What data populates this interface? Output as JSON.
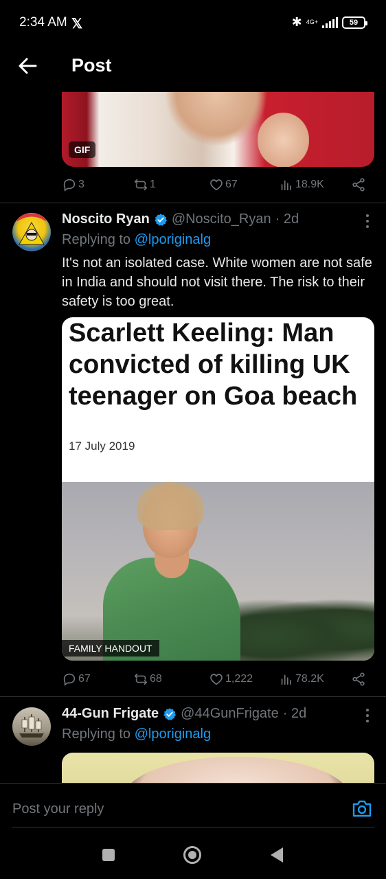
{
  "status_bar": {
    "time": "2:34 AM",
    "x_logo": "𝕏",
    "network": "4G+",
    "battery": "59"
  },
  "header": {
    "title": "Post"
  },
  "top_tweet": {
    "media_badge": "GIF",
    "replies": "3",
    "reposts": "1",
    "likes": "67",
    "views": "18.9K"
  },
  "tweet": {
    "name": "Noscito Ryan",
    "handle": "@Noscito_Ryan",
    "time": "· 2d",
    "replying_prefix": "Replying to ",
    "replying_to": "@lporiginalg",
    "text": "It's not an isolated case.  White women are not safe in India and should not visit there.  The risk to their safety is too great.",
    "article": {
      "headline": "Scarlett Keeling: Man convicted of killing UK teenager on Goa beach",
      "date": "17 July 2019",
      "caption": "FAMILY HANDOUT"
    },
    "replies": "67",
    "reposts": "68",
    "likes": "1,222",
    "views": "78.2K"
  },
  "third_tweet": {
    "name": "44-Gun Frigate",
    "handle": "@44GunFrigate",
    "time": "· 2d",
    "replying_prefix": "Replying to ",
    "replying_to": "@lporiginalg"
  },
  "reply_bar": {
    "placeholder": "Post your reply"
  },
  "colors": {
    "background": "#000000",
    "accent": "#1d9bf0",
    "muted": "#71767b",
    "text": "#e7e9ea"
  }
}
